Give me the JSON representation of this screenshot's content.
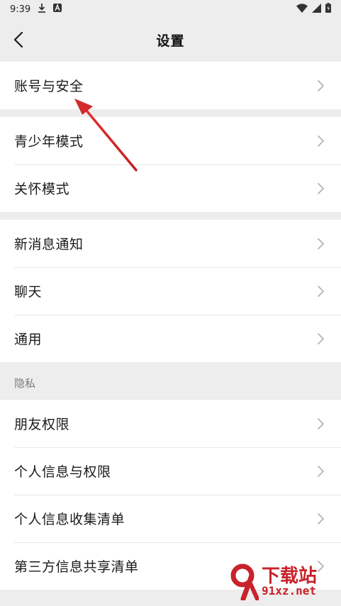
{
  "status_bar": {
    "time": "9:39"
  },
  "header": {
    "title": "设置"
  },
  "groups": {
    "account": {
      "items": [
        {
          "label": "账号与安全"
        }
      ]
    },
    "modes": {
      "items": [
        {
          "label": "青少年模式"
        },
        {
          "label": "关怀模式"
        }
      ]
    },
    "general": {
      "items": [
        {
          "label": "新消息通知"
        },
        {
          "label": "聊天"
        },
        {
          "label": "通用"
        }
      ]
    },
    "privacy": {
      "header": "隐私",
      "items": [
        {
          "label": "朋友权限"
        },
        {
          "label": "个人信息与权限"
        },
        {
          "label": "个人信息收集清单"
        },
        {
          "label": "第三方信息共享清单"
        }
      ]
    }
  },
  "watermark": {
    "line1": "下载站",
    "line2": "91xz.net"
  },
  "colors": {
    "background": "#ededed",
    "annotation_arrow": "#d42a2a",
    "watermark": "#c8222b"
  }
}
